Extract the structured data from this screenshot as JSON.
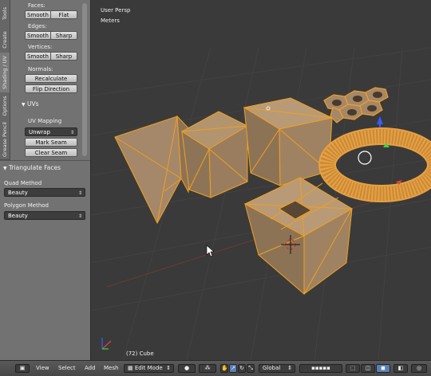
{
  "shelf": {
    "tabs": [
      "Tools",
      "Create",
      "Shading / UV",
      "Options",
      "Grease Pencil"
    ],
    "faces_label": "Faces:",
    "faces_smooth": "Smooth",
    "faces_flat": "Flat",
    "edges_label": "Edges:",
    "edges_smooth": "Smooth",
    "edges_sharp": "Sharp",
    "vertices_label": "Vertices:",
    "vertices_smooth": "Smooth",
    "vertices_sharp": "Sharp",
    "normals_label": "Normals:",
    "recalculate": "Recalculate",
    "flip_direction": "Flip Direction",
    "uvs_title": "UVs",
    "uv_mapping_label": "UV Mapping",
    "unwrap": "Unwrap",
    "mark_seam": "Mark Seam",
    "clear_seam": "Clear Seam",
    "operator_title": "Triangulate Faces",
    "quad_method_label": "Quad Method",
    "quad_method_value": "Beauty",
    "polygon_method_label": "Polygon Method",
    "polygon_method_value": "Beauty"
  },
  "viewport": {
    "view_name": "User Persp",
    "units": "Meters",
    "object_info": "(72) Cube"
  },
  "header": {
    "view": "View",
    "select": "Select",
    "add": "Add",
    "mesh": "Mesh",
    "mode": "Edit Mode",
    "orientation": "Global"
  },
  "colors": {
    "mesh_face": "#a58769",
    "mesh_edge": "#f0a020",
    "highlight": "#5a7fb5"
  }
}
